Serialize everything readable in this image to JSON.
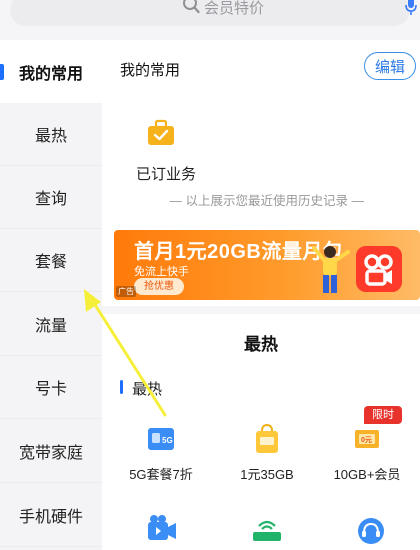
{
  "search": {
    "placeholder": "会员特价",
    "icon": "search-icon",
    "mic_icon": "microphone-icon"
  },
  "sidebar": {
    "items": [
      {
        "label": "我的常用",
        "active": true
      },
      {
        "label": "最热"
      },
      {
        "label": "查询"
      },
      {
        "label": "套餐"
      },
      {
        "label": "流量"
      },
      {
        "label": "号卡"
      },
      {
        "label": "宽带家庭"
      },
      {
        "label": "手机硬件"
      }
    ]
  },
  "main": {
    "section_title": "我的常用",
    "edit_label": "编辑",
    "subscribed": {
      "label": "已订业务",
      "icon": "briefcase-check-icon"
    },
    "history_note": "— 以上展示您最近使用历史记录 —",
    "banner": {
      "title": "首月1元20GB流量月包",
      "subtitle": "免流上快手",
      "button": "抢优惠",
      "ad_tag": "广告",
      "app_icon": "kuaishou-icon"
    },
    "hot": {
      "header": "最热",
      "sublabel": "最热",
      "items": [
        {
          "label": "5G套餐7折",
          "icon": "5g-sim-icon"
        },
        {
          "label": "1元35GB",
          "icon": "shopping-bag-icon"
        },
        {
          "label": "10GB+会员",
          "icon": "coupon-icon",
          "badge": "限时"
        }
      ],
      "icons_row2": [
        "video-camera-icon",
        "router-icon",
        "headset-icon"
      ]
    }
  },
  "colors": {
    "accent": "#1e6fff",
    "banner": "#ff7a0a",
    "badge": "#e8332c"
  }
}
